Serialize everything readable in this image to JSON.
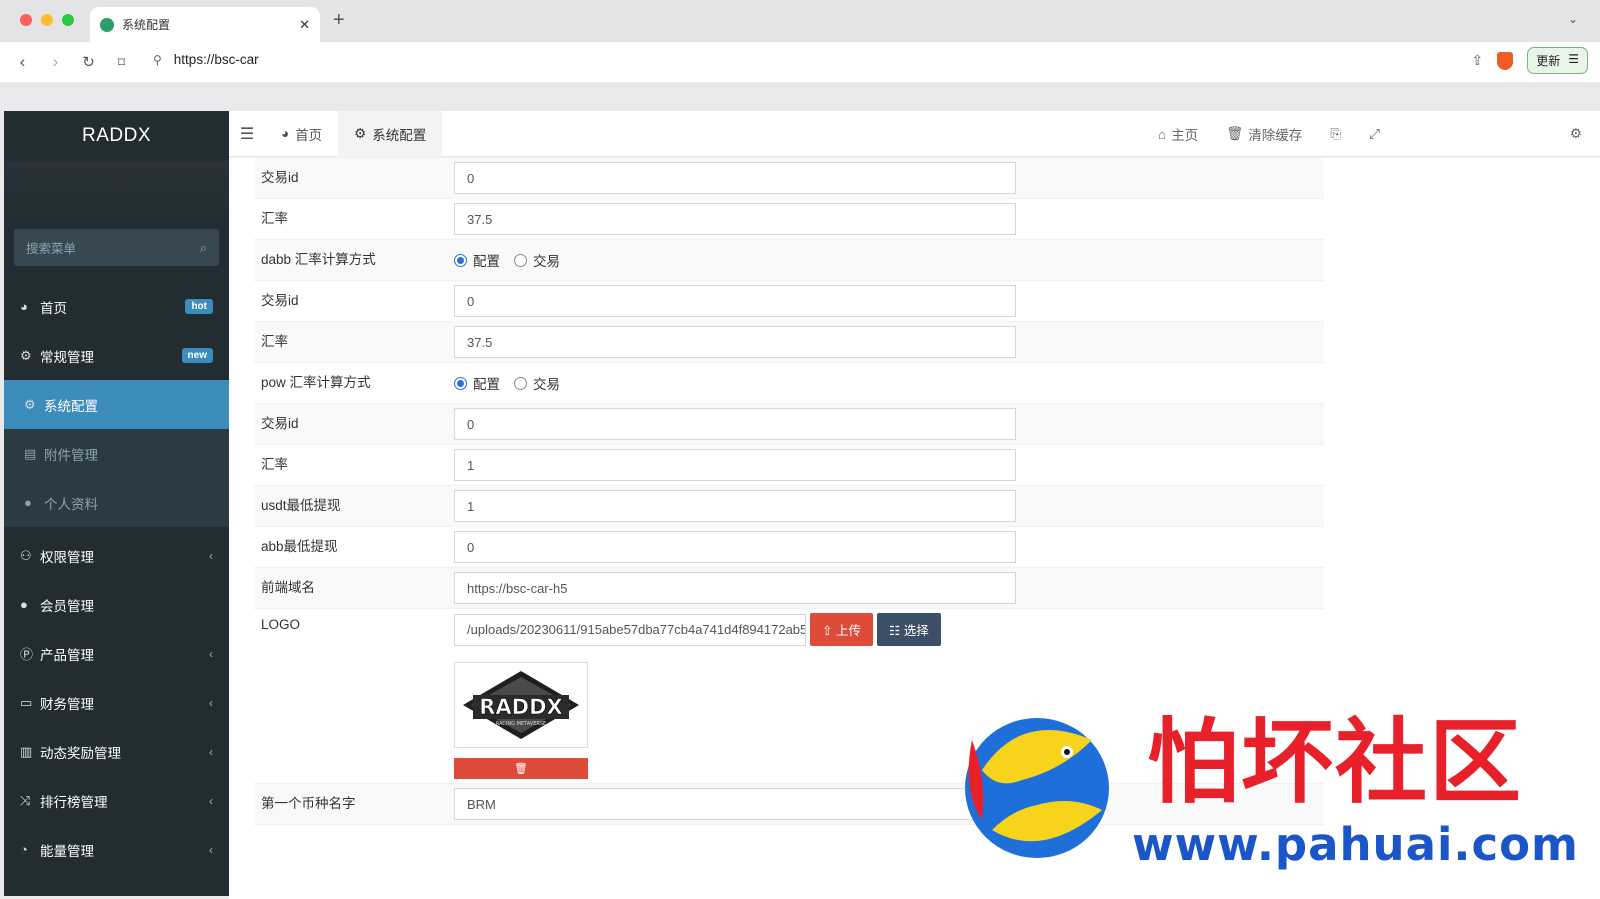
{
  "browser": {
    "tab_title": "系统配置",
    "url": "https://bsc-car",
    "update_label": "更新"
  },
  "sidebar": {
    "brand": "RADDX",
    "search_placeholder": "搜索菜单",
    "items": [
      {
        "label": "首页",
        "icon": "dashboard-icon",
        "badge": "hot",
        "badge_color": "#3c8dbc"
      },
      {
        "label": "常规管理",
        "icon": "cogs-icon",
        "badge": "new",
        "badge_color": "#3c8dbc"
      },
      {
        "label": "系统配置",
        "icon": "gear-icon",
        "active": true
      },
      {
        "label": "附件管理",
        "icon": "file-image-icon"
      },
      {
        "label": "个人资料",
        "icon": "user-icon"
      },
      {
        "label": "权限管理",
        "icon": "group-icon"
      },
      {
        "label": "会员管理",
        "icon": "user-icon"
      },
      {
        "label": "产品管理",
        "icon": "product-icon"
      },
      {
        "label": "财务管理",
        "icon": "card-icon"
      },
      {
        "label": "动态奖励管理",
        "icon": "trash-icon"
      },
      {
        "label": "排行榜管理",
        "icon": "random-icon"
      },
      {
        "label": "能量管理",
        "icon": "dashboard-icon"
      }
    ]
  },
  "topbar": {
    "tab_home": "首页",
    "tab_config": "系统配置",
    "home_link": "主页",
    "clear_cache": "清除缓存"
  },
  "form": {
    "rows": [
      {
        "label": "交易id",
        "value": "0"
      },
      {
        "label": "汇率",
        "value": "37.5"
      },
      {
        "label": "dabb 汇率计算方式",
        "radio": [
          "配置",
          "交易"
        ]
      },
      {
        "label": "交易id",
        "value": "0"
      },
      {
        "label": "汇率",
        "value": "37.5"
      },
      {
        "label": "pow 汇率计算方式",
        "radio": [
          "配置",
          "交易"
        ]
      },
      {
        "label": "交易id",
        "value": "0"
      },
      {
        "label": "汇率",
        "value": "1"
      },
      {
        "label": "usdt最低提现",
        "value": "1"
      },
      {
        "label": "abb最低提现",
        "value": "0"
      },
      {
        "label": "前端域名",
        "value": "https://bsc-car-h5"
      }
    ],
    "logo_label": "LOGO",
    "logo_path": "/uploads/20230611/915abe57dba77cb4a741d4f894172ab5",
    "upload_label": "上传",
    "select_label": "选择",
    "logo_text": "RADDX",
    "logo_subtext": "RACING METAVERSE",
    "last_label": "第一个币种名字",
    "last_value": "BRM"
  },
  "watermark": {
    "title": "怕坏社区",
    "url": "www.pahuai.com"
  }
}
